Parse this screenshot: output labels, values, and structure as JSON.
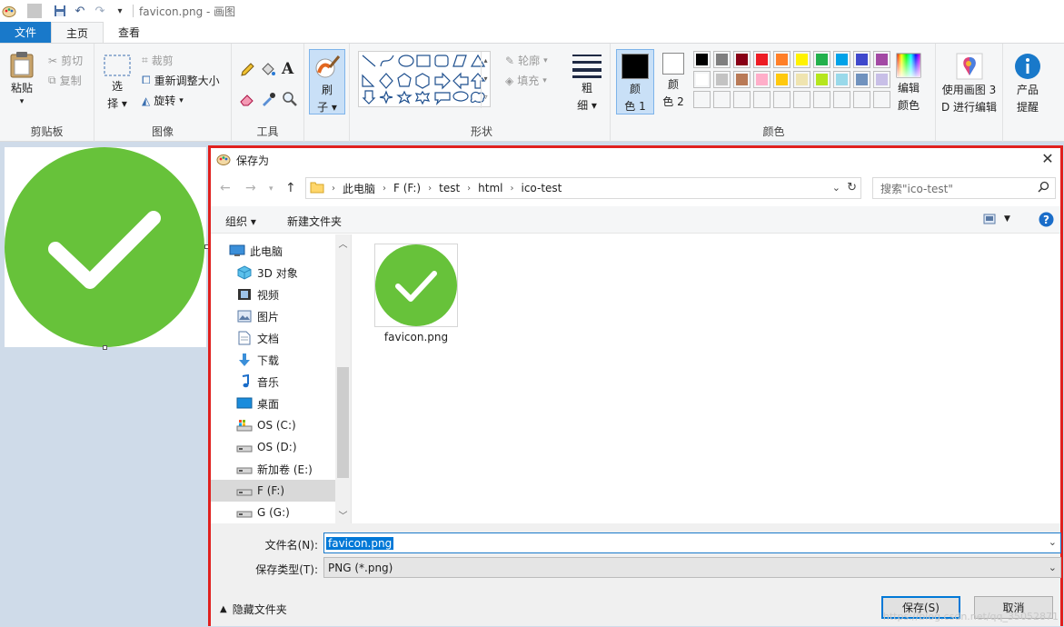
{
  "window": {
    "title": "favicon.png - 画图"
  },
  "tabs": [
    "文件",
    "主页",
    "查看"
  ],
  "ribbon": {
    "clipboard": {
      "paste": "粘贴",
      "cut": "剪切",
      "copy": "复制",
      "label": "剪贴板"
    },
    "image": {
      "select_l1": "选",
      "select_l2": "择",
      "crop": "裁剪",
      "resize": "重新调整大小",
      "rotate": "旋转",
      "label": "图像"
    },
    "tools": {
      "label": "工具"
    },
    "brush": {
      "l1": "刷",
      "l2": "子"
    },
    "shapes": {
      "outline": "轮廓",
      "fill": "填充",
      "label": "形状"
    },
    "size": {
      "l1": "粗",
      "l2": "细"
    },
    "color1": {
      "l1": "颜",
      "l2": "色 1"
    },
    "color2": {
      "l1": "颜",
      "l2": "色 2"
    },
    "colors_label": "颜色",
    "edit_colors": {
      "l1": "编辑",
      "l2": "颜色"
    },
    "paint3d": {
      "l1": "使用画图 3",
      "l2": "D 进行编辑"
    },
    "product": {
      "l1": "产品",
      "l2": "提醒"
    },
    "palette_row1": [
      "#000000",
      "#7f7f7f",
      "#880015",
      "#ed1c24",
      "#ff7f27",
      "#fff200",
      "#22b14c",
      "#00a2e8",
      "#3f48cc",
      "#a349a4"
    ],
    "palette_row2": [
      "#ffffff",
      "#c3c3c3",
      "#b97a57",
      "#ffaec9",
      "#ffc90e",
      "#efe4b0",
      "#b5e61d",
      "#99d9ea",
      "#7092be",
      "#c8bfe7"
    ],
    "palette_row3": [
      "#ffffff",
      "#ffffff",
      "#ffffff",
      "#ffffff",
      "#ffffff",
      "#ffffff",
      "#ffffff",
      "#ffffff",
      "#ffffff",
      "#ffffff"
    ]
  },
  "dialog": {
    "title": "保存为",
    "breadcrumb": [
      "此电脑",
      "F (F:)",
      "test",
      "html",
      "ico-test"
    ],
    "search_placeholder": "搜索\"ico-test\"",
    "organize": "组织",
    "new_folder": "新建文件夹",
    "nav_items": [
      {
        "label": "此电脑",
        "icon": "pc-icon"
      },
      {
        "label": "3D 对象",
        "icon": "cube-icon"
      },
      {
        "label": "视频",
        "icon": "video-icon"
      },
      {
        "label": "图片",
        "icon": "picture-icon"
      },
      {
        "label": "文档",
        "icon": "document-icon"
      },
      {
        "label": "下载",
        "icon": "download-icon"
      },
      {
        "label": "音乐",
        "icon": "music-icon"
      },
      {
        "label": "桌面",
        "icon": "desktop-icon"
      },
      {
        "label": "OS (C:)",
        "icon": "drive-c-icon"
      },
      {
        "label": "OS (D:)",
        "icon": "drive-icon"
      },
      {
        "label": "新加卷 (E:)",
        "icon": "drive-icon"
      },
      {
        "label": "F (F:)",
        "icon": "drive-icon"
      },
      {
        "label": "G (G:)",
        "icon": "drive-icon"
      }
    ],
    "file": {
      "name": "favicon.png"
    },
    "filename_label": "文件名(N):",
    "filename_value": "favicon.png",
    "filetype_label": "保存类型(T):",
    "filetype_value": "PNG (*.png)",
    "hide_folders": "隐藏文件夹",
    "save": "保存(S)",
    "cancel": "取消",
    "watermark": "https://blog.csdn.net/qq_35052871"
  },
  "colors": {
    "accent": "#1979ca",
    "check_green": "#67c23a",
    "dialog_border": "#e0201e"
  }
}
